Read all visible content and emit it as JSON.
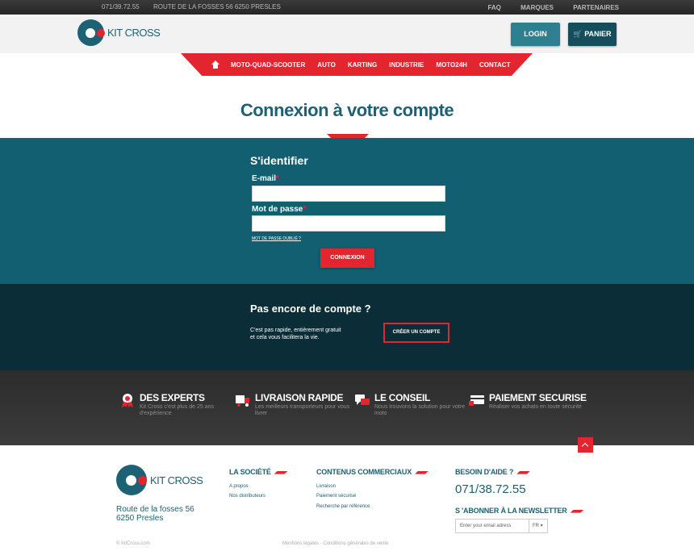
{
  "topbar": {
    "phone": "071/39.72.55",
    "address": "ROUTE DE LA FOSSES 56 6250 PRESLES",
    "links": [
      "FAQ",
      "MARQUES",
      "PARTENAIRES"
    ]
  },
  "header": {
    "logo_text": "KIT CROSS",
    "login_label": "LOGIN",
    "cart_label": "PANIER",
    "cart_icon": "cart-icon"
  },
  "nav": {
    "home_icon": "home-icon",
    "items": [
      "MOTO-QUAD-SCOOTER",
      "AUTO",
      "KARTING",
      "INDUSTRIE",
      "MOTO24H",
      "CONTACT"
    ]
  },
  "page": {
    "title": "Connexion à votre compte"
  },
  "login": {
    "heading": "S'identifier",
    "email_label": "E-mail",
    "password_label": "Mot de passe",
    "required_mark": "*",
    "email_value": "",
    "password_value": "",
    "forgot_label": "MOT DE PASSE OUBLIÉ ?",
    "submit_label": "CONNEXION"
  },
  "register": {
    "heading": "Pas encore de compte ?",
    "desc_line1": "C'est pas rapide, entièrement gratuit",
    "desc_line2": "et cela vous facilitera la vie.",
    "create_label": "CRÉER UN COMPTE"
  },
  "features": [
    {
      "title": "DES EXPERTS",
      "desc": "Kit Cross c'est plus de 25 ans d'expérience",
      "icon": "award-icon"
    },
    {
      "title": "LIVRAISON RAPIDE",
      "desc": "Les meilleurs transporteurs pour vous livrer",
      "icon": "truck-icon"
    },
    {
      "title": "LE CONSEIL",
      "desc": "Nous trouvons la solution pour votre moto",
      "icon": "chat-icon"
    },
    {
      "title": "PAIEMENT SECURISE",
      "desc": "Réaliser vos achats en toute sécurité",
      "icon": "secure-card-icon"
    }
  ],
  "footer": {
    "logo_text": "KIT CROSS",
    "address_line1": "Route de la fosses 56",
    "address_line2": "6250 Presles",
    "societe_title": "LA SOCIÉTÉ",
    "societe_links": [
      "A propos",
      "Nos distributeurs"
    ],
    "contenus_title": "CONTENUS COMMERCIAUX",
    "contenus_links": [
      "Livraison",
      "Paiement sécurisé",
      "Recherche par référence"
    ],
    "aide_title": "BESOIN D'AIDE ?",
    "phone": "071/38.72.55",
    "newsletter_title": "S 'ABONNER À LA NEWSLETTER",
    "newsletter_placeholder": "Enter your email adress",
    "lang": "FR",
    "copyright": "© KitCross.com",
    "legal": "Mentions légales · Conditions générales de vente"
  },
  "colors": {
    "brand_teal": "#1d6174",
    "accent_red": "#e3252f",
    "login_bg": "#125f71",
    "register_bg": "#0a2d37"
  }
}
